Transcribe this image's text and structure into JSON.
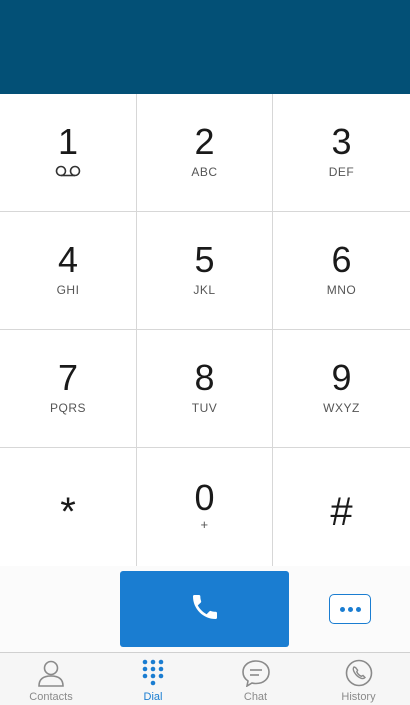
{
  "keys": [
    {
      "digit": "1",
      "letters": ""
    },
    {
      "digit": "2",
      "letters": "ABC"
    },
    {
      "digit": "3",
      "letters": "DEF"
    },
    {
      "digit": "4",
      "letters": "GHI"
    },
    {
      "digit": "5",
      "letters": "JKL"
    },
    {
      "digit": "6",
      "letters": "MNO"
    },
    {
      "digit": "7",
      "letters": "PQRS"
    },
    {
      "digit": "8",
      "letters": "TUV"
    },
    {
      "digit": "9",
      "letters": "WXYZ"
    },
    {
      "digit": "*",
      "letters": ""
    },
    {
      "digit": "0",
      "letters": "+"
    },
    {
      "digit": "#",
      "letters": ""
    }
  ],
  "tabs": [
    {
      "label": "Contacts",
      "icon": "person-icon"
    },
    {
      "label": "Dial",
      "icon": "dialpad-icon",
      "active": true
    },
    {
      "label": "Chat",
      "icon": "chat-bubble-icon"
    },
    {
      "label": "History",
      "icon": "phone-history-icon"
    }
  ],
  "colors": {
    "header": "#035076",
    "accent": "#1a7dd1",
    "tab_inactive": "#8a8a8a"
  }
}
